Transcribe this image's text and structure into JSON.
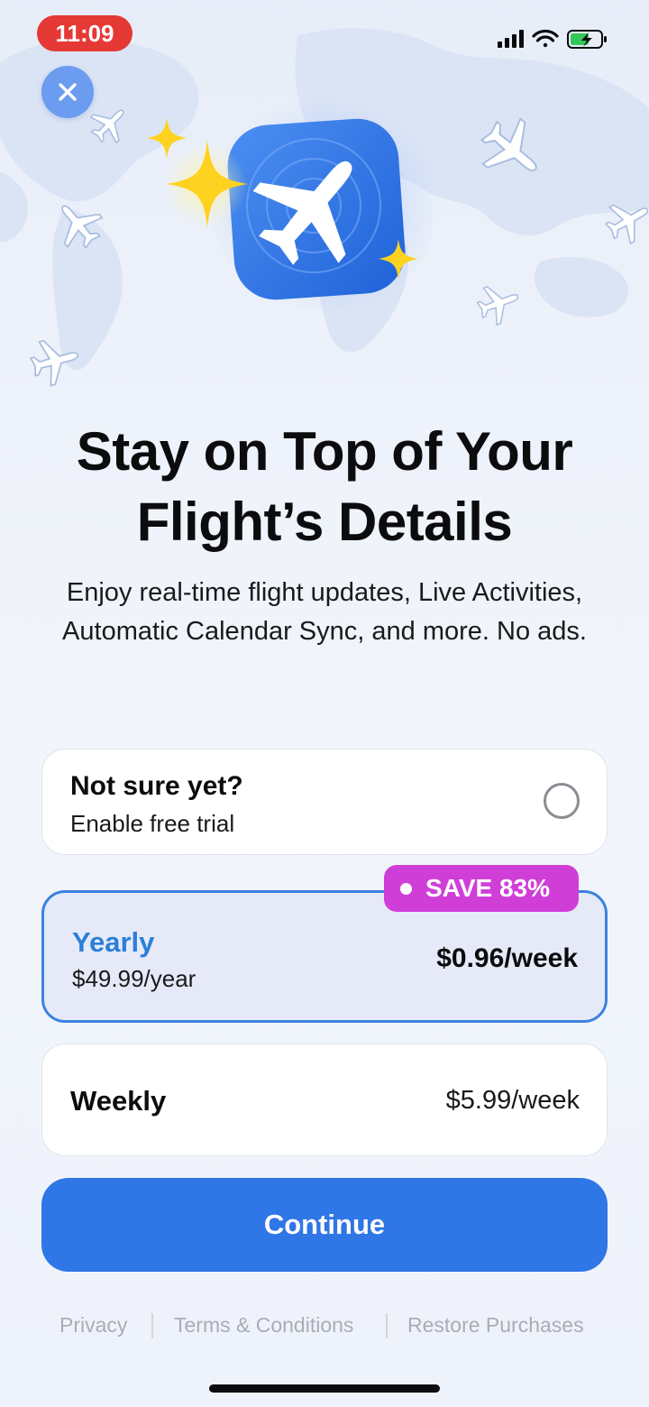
{
  "status_bar": {
    "time": "11:09",
    "signal_icon": "cellular-signal-icon",
    "wifi_icon": "wifi-icon",
    "battery_icon": "battery-charging-icon"
  },
  "close_icon": "close-icon",
  "hero_icon": "airplane-app-icon",
  "title_line1": "Stay on Top of Your",
  "title_line2": "Flight’s Details",
  "subtitle": "Enjoy real-time flight updates, Live Activities, Automatic Calendar Sync, and more. No ads.",
  "plans": {
    "trial": {
      "title": "Not sure yet?",
      "subtitle": "Enable free trial",
      "selected": false
    },
    "yearly": {
      "name": "Yearly",
      "price": "$49.99/year",
      "per_week": "$0.96/week",
      "badge": "SAVE 83%",
      "selected": true
    },
    "weekly": {
      "name": "Weekly",
      "price": "$5.99/week",
      "selected": false
    }
  },
  "continue_label": "Continue",
  "footer": {
    "privacy": "Privacy",
    "terms": "Terms & Conditions",
    "restore": "Restore Purchases"
  },
  "colors": {
    "accent": "#2f76e6",
    "selected_border": "#3a82e0",
    "badge": "#cf3fd8",
    "status_time_bg": "#e53935"
  }
}
